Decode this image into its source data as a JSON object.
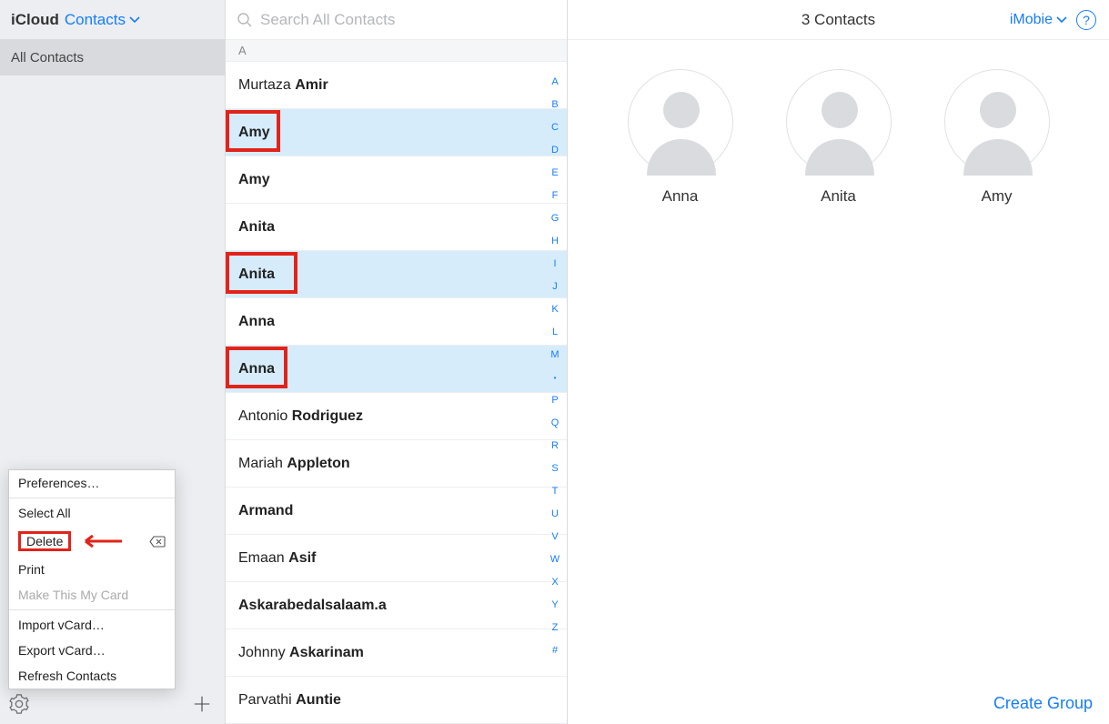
{
  "header": {
    "icloud": "iCloud",
    "contacts_label": "Contacts"
  },
  "sidebar": {
    "all_contacts": "All Contacts"
  },
  "context_menu": {
    "preferences": "Preferences…",
    "select_all": "Select All",
    "delete": "Delete",
    "print": "Print",
    "make_my_card": "Make This My Card",
    "import_vcard": "Import vCard…",
    "export_vcard": "Export vCard…",
    "refresh": "Refresh Contacts"
  },
  "search": {
    "placeholder": "Search All Contacts"
  },
  "section_letter": "A",
  "contacts": [
    {
      "first": "Murtaza",
      "last": "Amir",
      "selected": false,
      "box": false
    },
    {
      "first": "Amy",
      "last": "",
      "selected": true,
      "box": true
    },
    {
      "first": "Amy",
      "last": "",
      "selected": false,
      "box": false
    },
    {
      "first": "Anita",
      "last": "",
      "selected": false,
      "box": false
    },
    {
      "first": "Anita",
      "last": "",
      "selected": true,
      "box": true
    },
    {
      "first": "Anna",
      "last": "",
      "selected": false,
      "box": false
    },
    {
      "first": "Anna",
      "last": "",
      "selected": true,
      "box": true
    },
    {
      "first": "Antonio",
      "last": "Rodriguez",
      "selected": false,
      "box": false
    },
    {
      "first": "Mariah",
      "last": "Appleton",
      "selected": false,
      "box": false
    },
    {
      "first": "Armand",
      "last": "",
      "selected": false,
      "box": false
    },
    {
      "first": "Emaan",
      "last": "Asif",
      "selected": false,
      "box": false
    },
    {
      "first": "Askarabedalsalaam.a",
      "last": "",
      "selected": false,
      "box": false
    },
    {
      "first": "Johnny",
      "last": "Askarinam",
      "selected": false,
      "box": false
    },
    {
      "first": "Parvathi",
      "last": "Auntie",
      "selected": false,
      "box": false
    }
  ],
  "alpha": [
    "A",
    "B",
    "C",
    "D",
    "E",
    "F",
    "G",
    "H",
    "I",
    "J",
    "K",
    "L",
    "M",
    "•",
    "P",
    "Q",
    "R",
    "S",
    "T",
    "U",
    "V",
    "W",
    "X",
    "Y",
    "Z",
    "#"
  ],
  "detail": {
    "title": "3 Contacts",
    "imobie": "iMobie",
    "cards": [
      "Anna",
      "Anita",
      "Amy"
    ],
    "create_group": "Create Group"
  }
}
